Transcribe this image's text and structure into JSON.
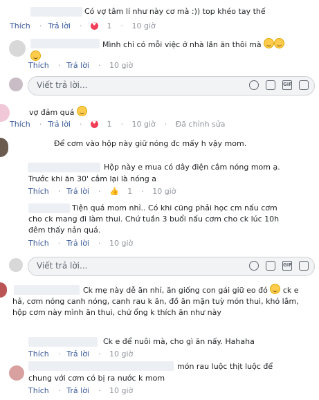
{
  "actions": {
    "like": "Thích",
    "reply": "Trả lời"
  },
  "reply_placeholder": "Viết trả lời...",
  "emoji_name": "grinning-face",
  "comments": [
    {
      "text": "Có vợ tâm lí như này cơ mà :)) top khéo tay thế",
      "likes": "1",
      "time": "10 giờ"
    },
    {
      "text": "Mình chỉ có mỗi việc ở nhà lần ăn thôi mà",
      "time": "10 giờ"
    },
    {
      "text": "vợ đảm quá",
      "likes": "1",
      "time": "10 giờ",
      "edited": "Đã chỉnh sửa"
    },
    {
      "text": "Để cơm vào hộp này giữ nóng đc mấy h vậy mom."
    },
    {
      "text_line1": "Hộp này e mua có dây điện cắm nóng mom ạ.",
      "text_line2": "Trước khi ăn 30' cắm lại là nóng a",
      "likes": "1",
      "time": "10 giờ"
    },
    {
      "text": "Tiện quá mom nhỉ.. Có khi cũng phải học cm nấu cơm cho ck mang đi làm thui. Chứ tuần 3 buổi nấu cơm cho ck lúc 10h đêm thấy nản quá.",
      "time": "10 giờ"
    },
    {
      "text": "Ck mẹ này dễ ăn nhỉ, ăn giống con gái giữ eo đó",
      "text_cont": "ck e hả, cơm nóng canh nóng, canh rau k ăn, đồ ăn mặn tuỳ món thui, khó lắm, hộp cơm này mình ăn thui, chứ ổng k thích ăn như này"
    },
    {
      "text": "Ck e để nuôi mà, cho gì ăn nấy. Hahaha",
      "time": "10 giờ"
    },
    {
      "text": "món rau luộc thịt luộc để",
      "text_line2": "chung với cơm có bị ra nước k mom",
      "time": "10 giờ"
    }
  ]
}
